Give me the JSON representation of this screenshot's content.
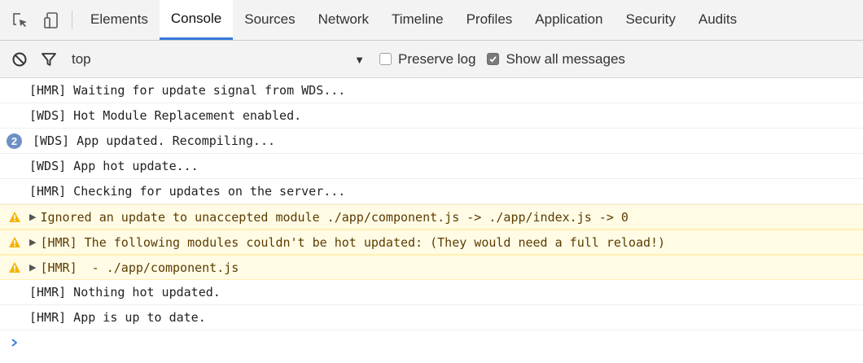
{
  "tabs": [
    {
      "label": "Elements",
      "active": false
    },
    {
      "label": "Console",
      "active": true
    },
    {
      "label": "Sources",
      "active": false
    },
    {
      "label": "Network",
      "active": false
    },
    {
      "label": "Timeline",
      "active": false
    },
    {
      "label": "Profiles",
      "active": false
    },
    {
      "label": "Application",
      "active": false
    },
    {
      "label": "Security",
      "active": false
    },
    {
      "label": "Audits",
      "active": false
    }
  ],
  "toolbar": {
    "context": "top",
    "preserve_log": {
      "label": "Preserve log",
      "checked": false
    },
    "show_all": {
      "label": "Show all messages",
      "checked": true
    }
  },
  "messages": [
    {
      "level": "log",
      "text": "[HMR] Waiting for update signal from WDS..."
    },
    {
      "level": "log",
      "text": "[WDS] Hot Module Replacement enabled."
    },
    {
      "level": "log",
      "text": "[WDS] App updated. Recompiling...",
      "count": "2"
    },
    {
      "level": "log",
      "text": "[WDS] App hot update..."
    },
    {
      "level": "log",
      "text": "[HMR] Checking for updates on the server..."
    },
    {
      "level": "warn",
      "text": "Ignored an update to unaccepted module ./app/component.js -> ./app/index.js -> 0"
    },
    {
      "level": "warn",
      "text": "[HMR] The following modules couldn't be hot updated: (They would need a full reload!)"
    },
    {
      "level": "warn",
      "text": "[HMR]  - ./app/component.js"
    },
    {
      "level": "log",
      "text": "[HMR] Nothing hot updated."
    },
    {
      "level": "log",
      "text": "[HMR] App is up to date."
    }
  ],
  "colors": {
    "active_tab_underline": "#3879d9",
    "warning_background": "#fffbe5",
    "warning_icon": "#f4b400",
    "count_badge": "#6e8fc6",
    "prompt": "#3879d9"
  },
  "icons": {
    "inspect": "inspect-element-icon",
    "device": "device-mode-icon",
    "clear": "clear-console-icon",
    "filter": "filter-icon",
    "warning": "warning-icon",
    "prompt": "prompt-chevron-icon"
  }
}
